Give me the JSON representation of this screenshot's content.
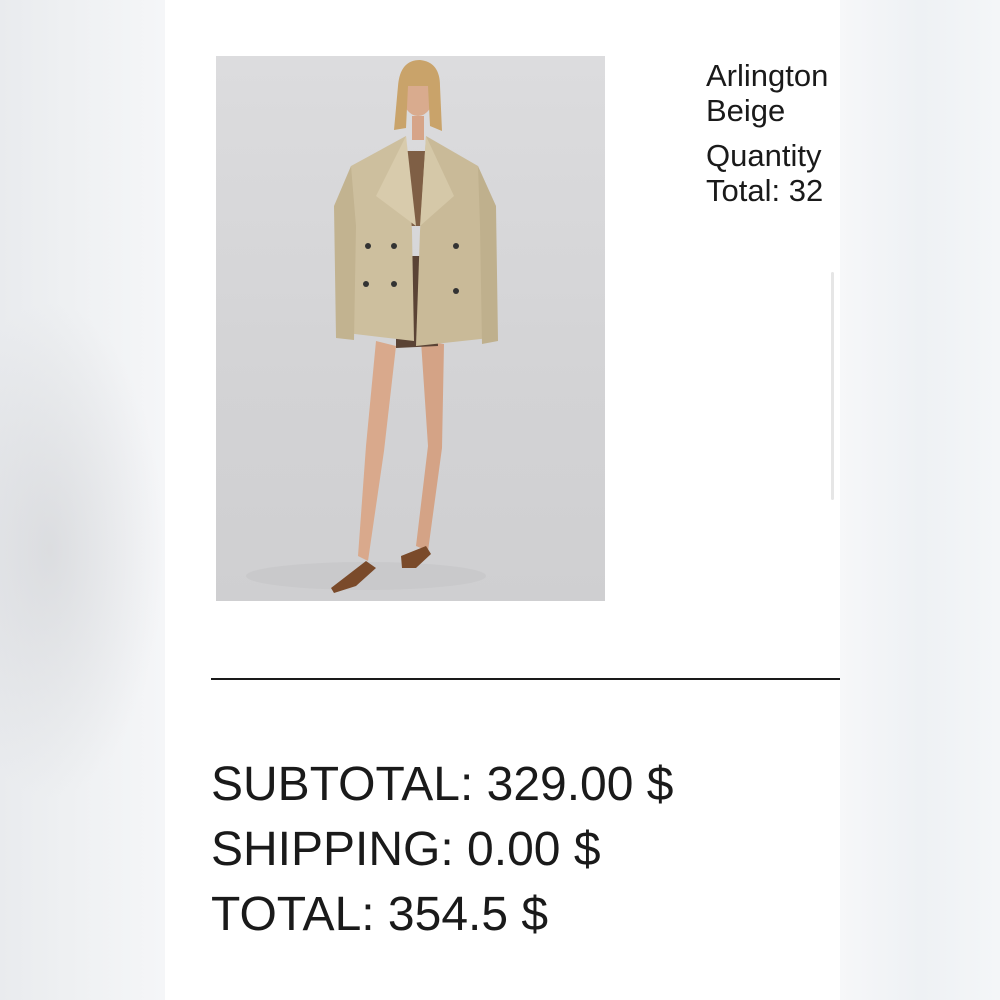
{
  "product": {
    "name": "Arlington",
    "color": "Beige",
    "quantity_label": "Quantity",
    "total_label": "Total: 32",
    "image": "model-wearing-beige-trench-jacket"
  },
  "summary": {
    "subtotal": "SUBTOTAL: 329.00 $",
    "shipping": "SHIPPING: 0.00 $",
    "total": "TOTAL: 354.5 $"
  },
  "colors": {
    "page_background": "#ffffff",
    "text": "#1a1a1a",
    "photo_background": "#d6d6d8",
    "coat": "#cdbf9e"
  }
}
